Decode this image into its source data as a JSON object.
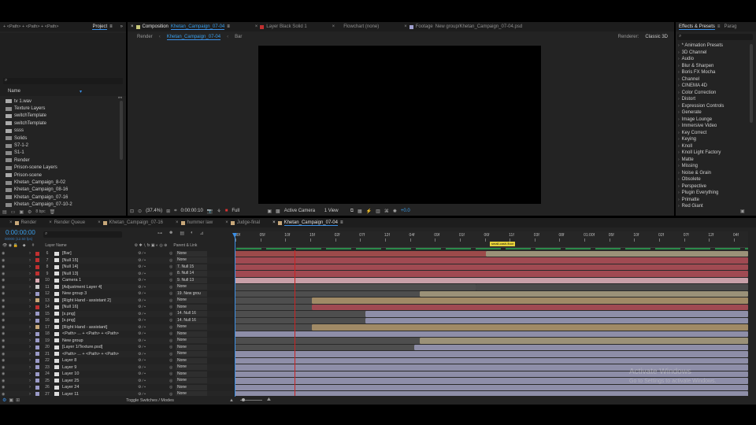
{
  "top_fragment": "+ <Path> + <Path> + <Path>",
  "project": {
    "tab": "Project",
    "column_name": "Name",
    "items": [
      {
        "label": "tv 1.wav",
        "type": "audio"
      },
      {
        "label": "Texture Layers",
        "type": "folder"
      },
      {
        "label": "switchTemplate",
        "type": "comp"
      },
      {
        "label": "switchTemplate",
        "type": "comp"
      },
      {
        "label": "ssss",
        "type": "comp"
      },
      {
        "label": "Solids",
        "type": "folder"
      },
      {
        "label": "S7-1-2",
        "type": "folder"
      },
      {
        "label": "S1-1",
        "type": "folder"
      },
      {
        "label": "Render",
        "type": "folder"
      },
      {
        "label": "Prison-scene Layers",
        "type": "folder"
      },
      {
        "label": "Prison-scene",
        "type": "comp"
      },
      {
        "label": "Khetan_Campaign_8-02",
        "type": "folder"
      },
      {
        "label": "Khetan_Campaign_08-16",
        "type": "folder"
      },
      {
        "label": "Khetan_Campaign_07-16",
        "type": "folder"
      },
      {
        "label": "Khetan_Campaign_07-10-2",
        "type": "folder"
      }
    ],
    "bpc": "8 bpc"
  },
  "viewer": {
    "tabs": [
      {
        "prefix": "Composition",
        "name": "Khetan_Campaign_07-04",
        "active": true,
        "color": "#c8c87a"
      },
      {
        "prefix": "",
        "name": "Layer Black Solid 1",
        "active": false,
        "color": "#c03030"
      },
      {
        "prefix": "",
        "name": "Flowchart (none)",
        "active": false,
        "color": ""
      },
      {
        "prefix": "Footage",
        "name": "New group/Khetan_Campaign_07-04.psd",
        "active": false,
        "color": "#a0a0d0"
      }
    ],
    "subtabs": [
      "Render",
      "Khetan_Campaign_07-04",
      "Bar"
    ],
    "renderer_label": "Renderer:",
    "renderer_value": "Classic 3D",
    "zoom": "(37.4%)",
    "timecode": "0:00:00:10",
    "resolution": "Full",
    "camera": "Active Camera",
    "views": "1 View",
    "exposure": "+0.0"
  },
  "effects": {
    "tabs": [
      "Effects & Presets",
      "Parag"
    ],
    "items": [
      "* Animation Presets",
      "3D Channel",
      "Audio",
      "Blur & Sharpen",
      "Boris FX Mocha",
      "Channel",
      "CINEMA 4D",
      "Color Correction",
      "Distort",
      "Expression Controls",
      "Generate",
      "Image Lounge",
      "Immersive Video",
      "Key Correct",
      "Keying",
      "Knoll",
      "Knoll Light Factory",
      "Matte",
      "Missing",
      "Noise & Grain",
      "Obsolete",
      "Perspective",
      "Plugin Everything",
      "Primatte",
      "Red Giant"
    ]
  },
  "timeline": {
    "tabs": [
      {
        "label": "Render",
        "color": "#c8a87a",
        "active": false
      },
      {
        "label": "Render Queue",
        "color": "",
        "active": false
      },
      {
        "label": "Khetan_Campaign_07-16",
        "color": "#c8a87a",
        "active": false
      },
      {
        "label": "hummer law",
        "color": "#c8a87a",
        "active": false
      },
      {
        "label": "Judge-final",
        "color": "#c8a87a",
        "active": false
      },
      {
        "label": "Khetan_Campaign_07-04",
        "color": "#c8a87a",
        "active": true
      }
    ],
    "timecode": "0:00:00:00",
    "frame_info": "00000 (12.50 fps)",
    "col_layer_name": "Layer Name",
    "col_parent": "Parent & Link",
    "ruler": [
      "00f",
      "05f",
      "10f",
      "15f",
      "02f",
      "07f",
      "12f",
      "04f",
      "09f",
      "01f",
      "06f",
      "11f",
      "03f",
      "08f",
      "01:00f",
      "05f",
      "10f",
      "02f",
      "07f",
      "12f",
      "04f"
    ],
    "marker_label": "small-cash-floor",
    "layers": [
      {
        "num": "6",
        "name": "[Bar]",
        "color": "#c03030",
        "parent": "None",
        "bar": {
          "start": 0.0,
          "end": 1.0,
          "in": 0.49,
          "color": "#9b9178",
          "pre": "#9c4a4a"
        }
      },
      {
        "num": "7",
        "name": "[Null 15]",
        "color": "#c03030",
        "parent": "None",
        "bar": {
          "start": 0.0,
          "end": 1.0,
          "in": 0.0,
          "color": "#a04a52",
          "pre": ""
        }
      },
      {
        "num": "8",
        "name": "[Null 14]",
        "color": "#c03030",
        "parent": "7. Null 15",
        "bar": {
          "start": 0.0,
          "end": 1.0,
          "in": 0.0,
          "color": "#a04a52",
          "pre": ""
        }
      },
      {
        "num": "9",
        "name": "[Null 13]",
        "color": "#c03030",
        "parent": "8. Null 14",
        "bar": {
          "start": 0.0,
          "end": 1.0,
          "in": 0.0,
          "color": "#a04a52",
          "pre": ""
        }
      },
      {
        "num": "10",
        "name": "Camera 1",
        "color": "#d8a8b0",
        "parent": "9. Null 13",
        "bar": {
          "start": 0.0,
          "end": 1.0,
          "in": 0.0,
          "color": "#c8a0a8",
          "pre": ""
        }
      },
      {
        "num": "11",
        "name": "[Adjustment Layer 4]",
        "color": "#c8c8c8",
        "parent": "None",
        "bar": {
          "start": 0.0,
          "end": 1.0,
          "in": 0.47,
          "color": "#4a4a4a",
          "pre": "#4e4e4e"
        }
      },
      {
        "num": "12",
        "name": "New group 3",
        "color": "#9a9ac8",
        "parent": "19. New grou",
        "bar": {
          "start": 0.0,
          "end": 1.0,
          "in": 0.36,
          "color": "#9b9178",
          "pre": "#4e4e4e"
        }
      },
      {
        "num": "13",
        "name": "[Right Hand - assistant 2]",
        "color": "#c8a87a",
        "parent": "None",
        "bar": {
          "start": 0.0,
          "end": 1.0,
          "in": 0.15,
          "color": "#a08a66",
          "pre": "#4e4e4e"
        }
      },
      {
        "num": "14",
        "name": "[Null 16]",
        "color": "#c03030",
        "parent": "None",
        "bar": {
          "start": 0.0,
          "end": 1.0,
          "in": 0.15,
          "color": "#a04a52",
          "pre": "#4e4e4e"
        }
      },
      {
        "num": "15",
        "name": "[s.png]",
        "color": "#9a9ac8",
        "parent": "14. Null 16",
        "bar": {
          "start": 0.0,
          "end": 1.0,
          "in": 0.255,
          "color": "#8e8ea8",
          "pre": "#4e4e4e"
        }
      },
      {
        "num": "16",
        "name": "[s.png]",
        "color": "#9a9ac8",
        "parent": "14. Null 16",
        "bar": {
          "start": 0.0,
          "end": 1.0,
          "in": 0.255,
          "color": "#8e8ea8",
          "pre": "#4e4e4e"
        }
      },
      {
        "num": "17",
        "name": "[Right Hand - assistant]",
        "color": "#c8a87a",
        "parent": "None",
        "bar": {
          "start": 0.0,
          "end": 1.0,
          "in": 0.15,
          "color": "#a08a66",
          "pre": "#4e4e4e"
        }
      },
      {
        "num": "18",
        "name": "<Path> ... + <Path> + <Path>",
        "color": "#9a9ac8",
        "parent": "None",
        "bar": {
          "start": 0.0,
          "end": 1.0,
          "in": 0.0,
          "color": "#8e8ea8",
          "pre": ""
        }
      },
      {
        "num": "19",
        "name": "New group",
        "color": "#9a9ac8",
        "parent": "None",
        "bar": {
          "start": 0.0,
          "end": 1.0,
          "in": 0.36,
          "color": "#9b9178",
          "pre": "#4e4e4e"
        }
      },
      {
        "num": "20",
        "name": "[Layer 1/Texture.psd]",
        "color": "#9a9ac8",
        "parent": "None",
        "bar": {
          "start": 0.0,
          "end": 1.0,
          "in": 0.35,
          "color": "#8e8ea8",
          "pre": "#4e4e4e"
        }
      },
      {
        "num": "21",
        "name": "<Path> ... + <Path> + <Path>",
        "color": "#9a9ac8",
        "parent": "None",
        "bar": {
          "start": 0.0,
          "end": 1.0,
          "in": 0.0,
          "color": "#8e8ea8",
          "pre": ""
        }
      },
      {
        "num": "22",
        "name": "Layer 8",
        "color": "#9a9ac8",
        "parent": "None",
        "bar": {
          "start": 0.0,
          "end": 1.0,
          "in": 0.0,
          "color": "#8e8ea8",
          "pre": ""
        }
      },
      {
        "num": "23",
        "name": "Layer 9",
        "color": "#9a9ac8",
        "parent": "None",
        "bar": {
          "start": 0.0,
          "end": 1.0,
          "in": 0.0,
          "color": "#8e8ea8",
          "pre": ""
        }
      },
      {
        "num": "24",
        "name": "Layer 10",
        "color": "#9a9ac8",
        "parent": "None",
        "bar": {
          "start": 0.0,
          "end": 1.0,
          "in": 0.0,
          "color": "#8e8ea8",
          "pre": ""
        }
      },
      {
        "num": "25",
        "name": "Layer 25",
        "color": "#9a9ac8",
        "parent": "None",
        "bar": {
          "start": 0.0,
          "end": 1.0,
          "in": 0.0,
          "color": "#8e8ea8",
          "pre": ""
        }
      },
      {
        "num": "26",
        "name": "Layer 24",
        "color": "#9a9ac8",
        "parent": "None",
        "bar": {
          "start": 0.0,
          "end": 1.0,
          "in": 0.0,
          "color": "#8e8ea8",
          "pre": ""
        }
      },
      {
        "num": "27",
        "name": "Layer 11",
        "color": "#9a9ac8",
        "parent": "None",
        "bar": {
          "start": 0.0,
          "end": 1.0,
          "in": 0.0,
          "color": "#8e8ea8",
          "pre": ""
        }
      }
    ],
    "toggle_label": "Toggle Switches / Modes"
  },
  "watermark": {
    "title": "Activate Windows",
    "subtitle": "Go to Settings to activate Windows."
  },
  "colors": {
    "accent": "#3a90e8",
    "playhead": "#cc2222",
    "work_area": "#2a8a4a"
  }
}
